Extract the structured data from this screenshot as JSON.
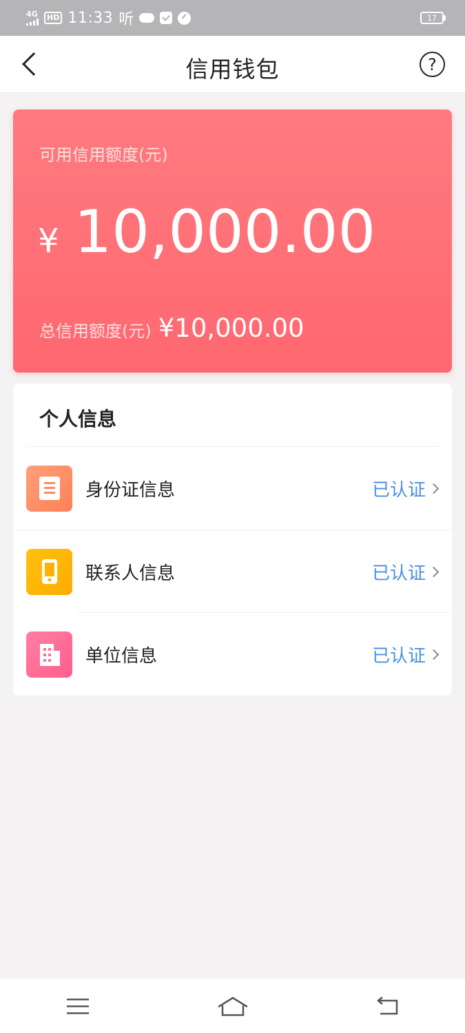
{
  "status_bar": {
    "network": "4G",
    "hd": "HD",
    "time": "11:33",
    "listen": "听",
    "battery": "17",
    "icons": [
      "signal-icon",
      "cloud-icon",
      "mail-icon",
      "speed-icon",
      "battery-icon"
    ]
  },
  "header": {
    "title": "信用钱包",
    "back_icon": "back-arrow-icon",
    "help_icon": "help-icon",
    "help_symbol": "?"
  },
  "credit": {
    "available_label": "可用信用额度(元)",
    "currency": "¥",
    "available_amount": "10,000.00",
    "total_label": "总信用额度(元)",
    "total_amount": "¥10,000.00",
    "gradient": [
      "#ff7a7f",
      "#ff6870"
    ]
  },
  "personal_info": {
    "title": "个人信息",
    "items": [
      {
        "label": "身份证信息",
        "status": "已认证",
        "icon": "id-card-icon",
        "color": "#ff8a62"
      },
      {
        "label": "联系人信息",
        "status": "已认证",
        "icon": "phone-icon",
        "color": "#ffb300"
      },
      {
        "label": "单位信息",
        "status": "已认证",
        "icon": "building-icon",
        "color": "#ff6e97"
      }
    ],
    "status_color": "#4a90e2"
  },
  "bottom_nav": {
    "items": [
      "menu-icon",
      "home-icon",
      "return-icon"
    ]
  }
}
